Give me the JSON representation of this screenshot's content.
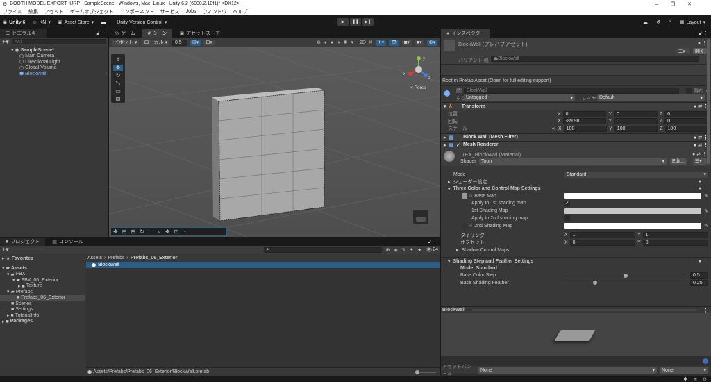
{
  "window": {
    "title": "BOOTH MODEL EXPORT_URP - SampleScene - Windows, Mac, Linux - Unity 6.2 (6000.2.10f1)* <DX12>"
  },
  "menu": [
    "ファイル",
    "編集",
    "アセット",
    "ゲームオブジェクト",
    "コンポーネント",
    "サービス",
    "Jobs",
    "ウィンドウ",
    "ヘルプ"
  ],
  "toolbar": {
    "unity": "Unity 6",
    "account": "KN",
    "asset_store": "Asset Store",
    "version_control": "Unity Version Control",
    "layout": "Layout"
  },
  "hierarchy": {
    "tab": "ヒエラルキー",
    "search_placeholder": "All",
    "scene": "SampleScene*",
    "items": [
      "Main Camera",
      "Directional Light",
      "Global Volume",
      "BlockWall"
    ]
  },
  "scene_tabs": [
    "ゲーム",
    "シーン",
    "アセットストア"
  ],
  "scene_toolbar": {
    "pivot": "ピボット",
    "local": "ローカル",
    "snap": "0.5",
    "mode_2d": "2D"
  },
  "scene": {
    "persp": "< Persp",
    "axes": [
      "y",
      "x",
      "z"
    ]
  },
  "project": {
    "tabs": [
      "プロジェクト",
      "コンソール"
    ],
    "count": "24",
    "favorites": "Favorites",
    "tree": [
      "Assets",
      "FBX",
      "FBX_06_Exterior",
      "Texture",
      "Prefabs",
      "Prefabs_06_Exterior",
      "Scenes",
      "Settings",
      "TutorialInfo",
      "Packages"
    ],
    "breadcrumb": [
      "Assets",
      "Prefabs",
      "Prefabs_06_Exterior"
    ],
    "items": [
      "BlockWall"
    ],
    "path": "Assets/Prefabs/Prefabs_06_Exterior/BlockWall.prefab"
  },
  "inspector": {
    "tab": "インスペクター",
    "title": "BlockWall (プレハブアセット)",
    "open": "開く",
    "variant_label": "バリアント 親",
    "variant_value": "BlockWall",
    "root_note": "Root in Prefab Asset (Open for full editing support)",
    "name": "BlockWall",
    "static": "静的",
    "tag_label": "タグ",
    "tag": "Untagged",
    "layer_label": "レイヤー",
    "layer": "Default",
    "transform": {
      "title": "Transform",
      "rows": [
        {
          "label": "位置",
          "x": "0",
          "y": "0",
          "z": "0"
        },
        {
          "label": "回転",
          "x": "-89.98",
          "y": "0",
          "z": "0"
        },
        {
          "label": "スケール",
          "x": "100",
          "y": "100",
          "z": "100"
        }
      ]
    },
    "mesh_filter": "Block Wall (Mesh Filter)",
    "mesh_renderer": "Mesh Renderer",
    "material": {
      "name": "TEX_BlockWall (Material)",
      "shader_label": "Shader",
      "shader": "Toon",
      "edit": "Edit..."
    },
    "mode_label": "Mode",
    "mode": "Standard",
    "shader_settings": "シェーダー設定",
    "three_color": "Three Color and Control Map Settings",
    "base_map": "Base Map",
    "apply1": "Apply to 1st shading map",
    "apply1_checked": true,
    "shading1": "1st Shading Map",
    "apply2": "Apply to 2nd shading map",
    "apply2_checked": false,
    "shading2": "2nd Shading Map",
    "tiling_label": "タイリング",
    "tiling": {
      "x": "1",
      "y": "1"
    },
    "offset_label": "オフセット",
    "offset": {
      "x": "0",
      "y": "0"
    },
    "shadow_maps": "Shadow Control Maps",
    "step_feather": "Shading Step and Feather Settings",
    "step_mode": "Mode: Standard",
    "base_color_step_label": "Base Color Step",
    "base_color_step": "0.5",
    "base_shading_feather_label": "Base Shading Feather",
    "base_shading_feather": "0.25",
    "preview_title": "BlockWall",
    "asset_bundle_label": "アセットバンドル",
    "asset_bundle": "None",
    "asset_bundle_variant": "None"
  }
}
